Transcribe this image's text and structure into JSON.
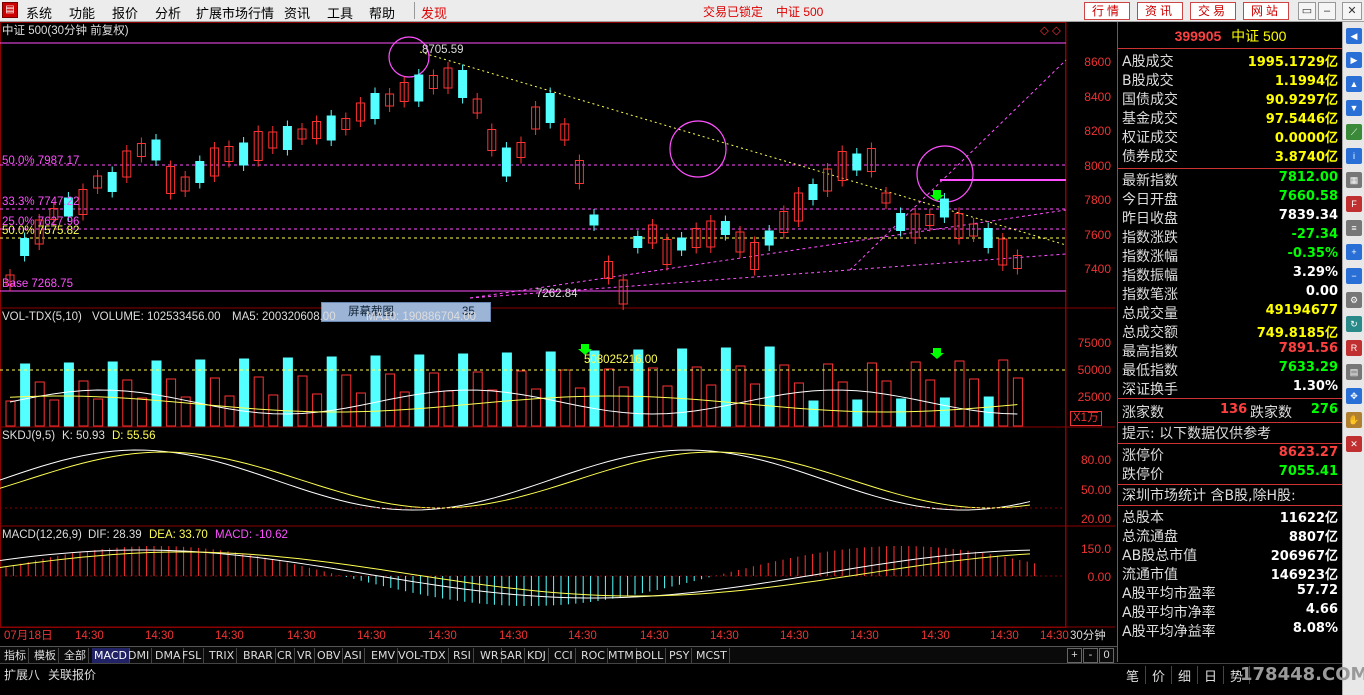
{
  "menubar": {
    "items": [
      "系统",
      "功能",
      "报价",
      "分析",
      "扩展市场行情",
      "资讯",
      "工具",
      "帮助"
    ],
    "alert_item": "发现",
    "center_left": "交易已锁定",
    "center_right": "中证 500",
    "trade_buttons": [
      "行情",
      "资讯",
      "交易",
      "网站"
    ],
    "window_buttons": [
      "▭",
      "–",
      "▢",
      "✕"
    ]
  },
  "chart": {
    "title": "中证 500(30分钟 前复权)",
    "price_axis": [
      "8600",
      "8400",
      "8200",
      "8000",
      "7800",
      "7600",
      "7400"
    ],
    "high_label": "8705.59",
    "low_label": "7262.84",
    "fib_labels": [
      "50.0% 7987.17",
      "33.3% 7747.22",
      "25.0% 7627.96",
      "50.0% 7575.82",
      "Base 7268.75"
    ],
    "tooltip_label": "屏幕截图",
    "tooltip_number": "35",
    "volume_header": {
      "title": "VOL-TDX(5,10)",
      "volume": "VOLUME: 102533456.00",
      "ma5": "MA5: 200320608.00",
      "ma10": "MA10: 190886704.00"
    },
    "volume_axis": [
      "75000",
      "50000",
      "25000"
    ],
    "volume_unit": "X1万",
    "volume_peak_label": "508025216.00",
    "skdj_header": {
      "title": "SKDJ(9,5)",
      "k": "K: 50.93",
      "d": "D: 55.56"
    },
    "skdj_axis": [
      "80.00",
      "50.00",
      "20.00"
    ],
    "macd_header": {
      "title": "MACD(12,26,9)",
      "dif": "DIF: 28.39",
      "dea": "DEA: 33.70",
      "macd": "MACD: -10.62"
    },
    "macd_axis": [
      "150.0",
      "0.00"
    ],
    "time_axis": [
      "07月18日",
      "14:30",
      "14:30",
      "14:30",
      "14:30",
      "14:30",
      "14:30",
      "14:30",
      "14:30",
      "14:30",
      "14:30",
      "14:30",
      "14:30",
      "14:30",
      "14:30",
      "14:30"
    ],
    "period_label": "30分钟",
    "colors": {
      "up": "#ff3232",
      "down": "#54ffff",
      "grid": "#8b0000",
      "fib": "#ff50ff",
      "trend": "#ffff54"
    }
  },
  "panel": {
    "code": "399905",
    "name": "中证 500",
    "rows1": [
      {
        "k": "A股成交",
        "v": "1995.1729亿",
        "c": "#ffff00"
      },
      {
        "k": "B股成交",
        "v": "1.1994亿",
        "c": "#ffff00"
      },
      {
        "k": "国债成交",
        "v": "90.9297亿",
        "c": "#ffff00"
      },
      {
        "k": "基金成交",
        "v": "97.5446亿",
        "c": "#ffff00"
      },
      {
        "k": "权证成交",
        "v": "0.0000亿",
        "c": "#ffff00"
      },
      {
        "k": "债券成交",
        "v": "3.8740亿",
        "c": "#ffff00"
      }
    ],
    "rows2": [
      {
        "k": "最新指数",
        "v": "7812.00",
        "c": "#00ff00"
      },
      {
        "k": "今日开盘",
        "v": "7660.58",
        "c": "#00ff00"
      },
      {
        "k": "昨日收盘",
        "v": "7839.34",
        "c": "#ffffff"
      },
      {
        "k": "指数涨跌",
        "v": "-27.34",
        "c": "#00ff00"
      },
      {
        "k": "指数涨幅",
        "v": "-0.35%",
        "c": "#00ff00"
      },
      {
        "k": "指数振幅",
        "v": "3.29%",
        "c": "#ffffff"
      },
      {
        "k": "指数笔涨",
        "v": "0.00",
        "c": "#ffffff"
      },
      {
        "k": "总成交量",
        "v": "49194677",
        "c": "#ffff00"
      },
      {
        "k": "总成交额",
        "v": "749.8185亿",
        "c": "#ffff00"
      },
      {
        "k": "最高指数",
        "v": "7891.56",
        "c": "#ff4040"
      },
      {
        "k": "最低指数",
        "v": "7633.29",
        "c": "#00ff00"
      },
      {
        "k": "深证换手",
        "v": "1.30%",
        "c": "#ffffff"
      }
    ],
    "up_label": "涨家数",
    "up_value": "136",
    "down_label": "跌家数",
    "down_value": "276",
    "hint": "提示: 以下数据仅供参考",
    "rows3": [
      {
        "k": "涨停价",
        "v": "8623.27",
        "c": "#ff4040"
      },
      {
        "k": "跌停价",
        "v": "7055.41",
        "c": "#00ff00"
      }
    ],
    "stat_title": "深圳市场统计 含B股,除H股:",
    "rows4": [
      {
        "k": "总股本",
        "v": "11622亿",
        "c": "#ffffff"
      },
      {
        "k": "总流通盘",
        "v": "8807亿",
        "c": "#ffffff"
      },
      {
        "k": "AB股总市值",
        "v": "206967亿",
        "c": "#ffffff"
      },
      {
        "k": "流通市值",
        "v": "146923亿",
        "c": "#ffffff"
      },
      {
        "k": "A股平均市盈率",
        "v": "57.72",
        "c": "#ffffff"
      },
      {
        "k": "A股平均市净率",
        "v": "4.66",
        "c": "#ffffff"
      },
      {
        "k": "A股平均净益率",
        "v": "8.08%",
        "c": "#ffffff"
      }
    ]
  },
  "tabs": [
    "指标",
    "模板",
    "全部",
    "MACD",
    "DMI",
    "DMA",
    "FSL",
    "TRIX",
    "BRAR",
    "CR",
    "VR",
    "OBV",
    "ASI",
    "EMV",
    "VOL-TDX",
    "RSI",
    "WR",
    "SAR",
    "KDJ",
    "CCI",
    "ROC",
    "MTM",
    "BOLL",
    "PSY",
    "MCST"
  ],
  "tab_controls": [
    "+",
    "-",
    "0"
  ],
  "status": {
    "left": [
      "扩展八",
      "关联报价"
    ],
    "buttons": [
      "笔",
      "价",
      "细",
      "日",
      "势"
    ],
    "watermark": "178448.COM"
  },
  "sidebar_icons": [
    "arrow-left-icon",
    "arrow-right-icon",
    "arrow-up-icon",
    "arrow-down-icon",
    "chart-line-icon",
    "info-icon",
    "table-icon",
    "f10-icon",
    "list-icon",
    "zoom-in-icon",
    "zoom-out-icon",
    "settings-icon",
    "refresh-icon",
    "rsi-icon",
    "report-icon",
    "move-icon",
    "hand-icon",
    "trash-icon"
  ]
}
